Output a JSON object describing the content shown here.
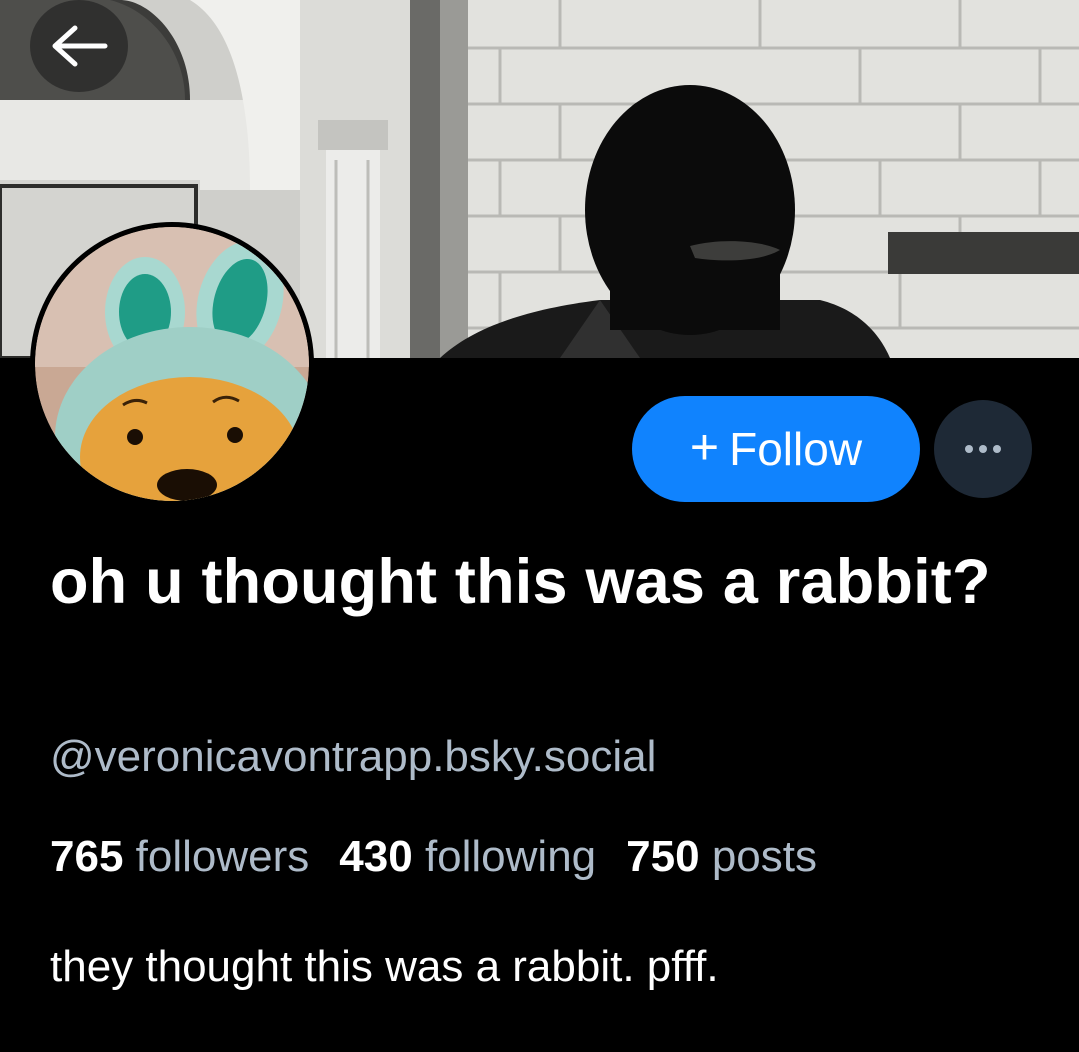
{
  "profile": {
    "display_name": "oh u thought this was a rabbit?",
    "handle": "@veronicavontrapp.bsky.social",
    "bio": "they thought this was a rabbit. pfff."
  },
  "stats": {
    "followers_count": "765",
    "followers_label": "followers",
    "following_count": "430",
    "following_label": "following",
    "posts_count": "750",
    "posts_label": "posts"
  },
  "actions": {
    "follow_plus": "+",
    "follow_label": "Follow"
  },
  "icons": {
    "back": "arrow-left-icon",
    "more": "ellipsis-icon"
  },
  "colors": {
    "accent": "#1083fe",
    "background": "#000000",
    "muted_text": "#aebbc9",
    "more_button": "#1e2936"
  }
}
